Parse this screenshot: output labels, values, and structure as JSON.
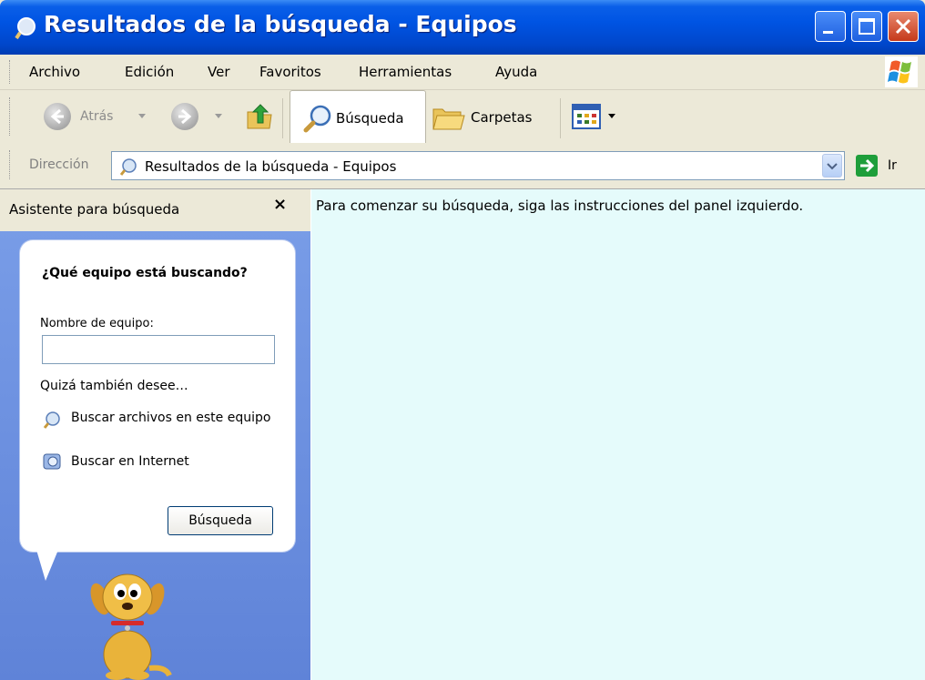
{
  "window": {
    "title": "Resultados de la búsqueda - Equipos"
  },
  "menubar": {
    "items": [
      "Archivo",
      "Edición",
      "Ver",
      "Favoritos",
      "Herramientas",
      "Ayuda"
    ]
  },
  "toolbar": {
    "back_label": "Atrás",
    "search_label": "Búsqueda",
    "folders_label": "Carpetas"
  },
  "address": {
    "label": "Dirección",
    "value": "Resultados de la búsqueda - Equipos",
    "go_label": "Ir"
  },
  "search_pane": {
    "title": "Asistente para búsqueda",
    "close": "×",
    "question": "¿Qué equipo está buscando?",
    "name_label": "Nombre de equipo:",
    "name_value": "",
    "also_label": "Quizá también desee…",
    "links": [
      "Buscar archivos en este equipo",
      "Buscar en Internet"
    ],
    "search_button": "Búsqueda"
  },
  "content": {
    "message": "Para comenzar su búsqueda, siga las instrucciones del panel izquierdo."
  },
  "colors": {
    "titlebar": "#0054E3",
    "pane_bg": "#7A9EE8",
    "content_bg": "#E5FBFB",
    "window_bg": "#ECE9D8"
  }
}
